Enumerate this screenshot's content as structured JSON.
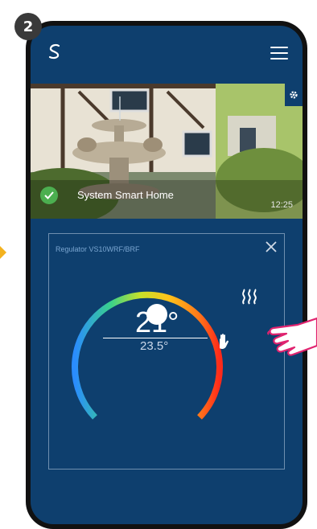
{
  "step": "2",
  "header": {
    "logo": "s-logo-icon",
    "menu_icon": "hamburger-menu-icon"
  },
  "photo": {
    "label": "System Smart Home",
    "time": "12:25",
    "settings_icon": "gear-icon",
    "status_icon": "check-icon"
  },
  "card": {
    "title": "Regulator VS10WRF/BRF",
    "close_icon": "close-icon",
    "current_temp": "21°",
    "set_temp": "23.5°",
    "heat_icon": "heating-icon",
    "manual_icon": "hand-icon"
  },
  "colors": {
    "screen_bg": "#0e3f6e",
    "accent": "#f3b21f"
  }
}
